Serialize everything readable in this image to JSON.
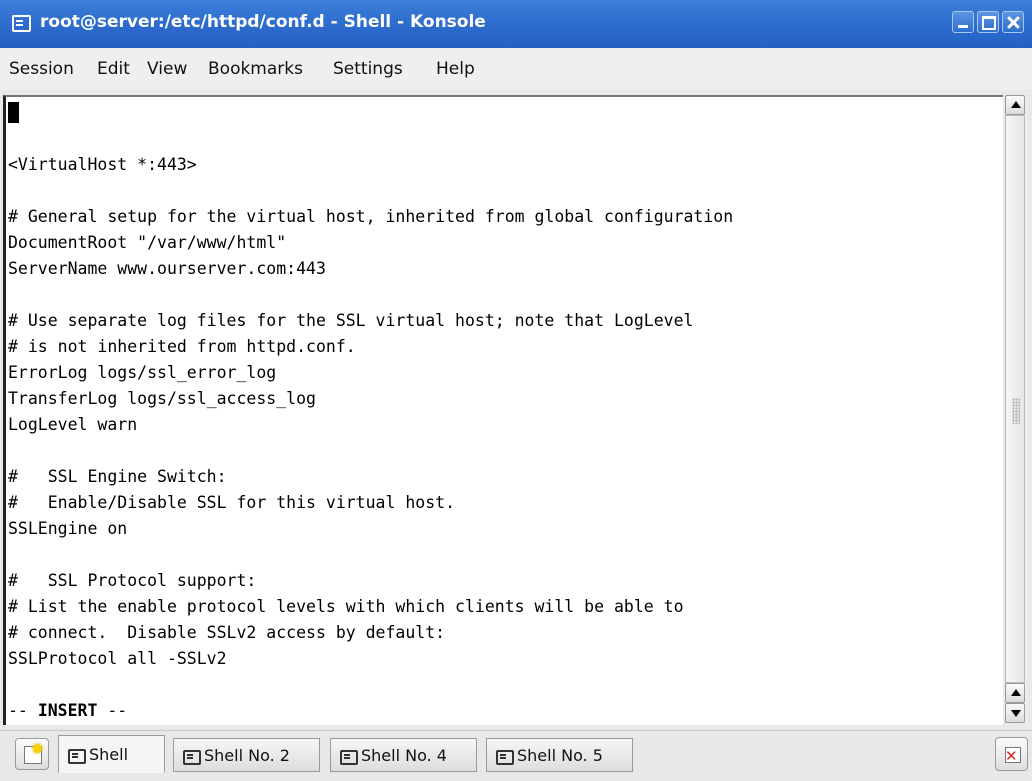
{
  "window": {
    "title": "root@server:/etc/httpd/conf.d - Shell - Konsole"
  },
  "menu": [
    "Session",
    "Edit",
    "View",
    "Bookmarks",
    "Settings",
    "Help"
  ],
  "terminal": {
    "lines": [
      "",
      "",
      "<VirtualHost *:443>",
      "",
      "# General setup for the virtual host, inherited from global configuration",
      "DocumentRoot \"/var/www/html\"",
      "ServerName www.ourserver.com:443",
      "",
      "# Use separate log files for the SSL virtual host; note that LogLevel",
      "# is not inherited from httpd.conf.",
      "ErrorLog logs/ssl_error_log",
      "TransferLog logs/ssl_access_log",
      "LogLevel warn",
      "",
      "#   SSL Engine Switch:",
      "#   Enable/Disable SSL for this virtual host.",
      "SSLEngine on",
      "",
      "#   SSL Protocol support:",
      "# List the enable protocol levels with which clients will be able to",
      "# connect.  Disable SSLv2 access by default:",
      "SSLProtocol all -SSLv2",
      "",
      ""
    ],
    "mode_prefix": "-- ",
    "mode_label": "INSERT",
    "mode_suffix": " --"
  },
  "tabs": [
    "Shell",
    "Shell No. 2",
    "Shell No. 4",
    "Shell No. 5"
  ],
  "icons": {
    "app": "konsole-icon",
    "new_tab": "new-session-icon",
    "close_tab": "close-session-icon"
  }
}
